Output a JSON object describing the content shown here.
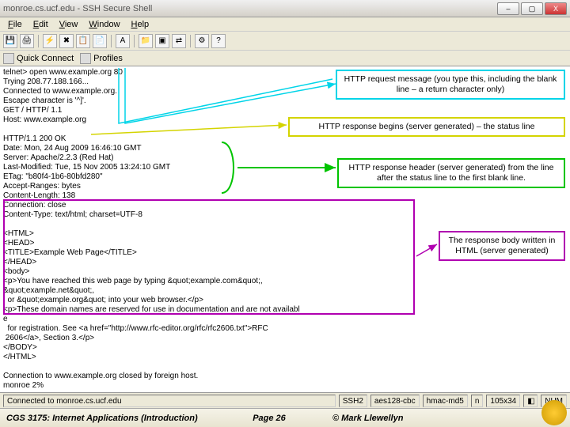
{
  "window": {
    "title": "monroe.cs.ucf.edu - SSH Secure Shell",
    "menus": [
      "File",
      "Edit",
      "View",
      "Window",
      "Help"
    ],
    "quickbar": {
      "connect": "Quick Connect",
      "profiles": "Profiles"
    }
  },
  "terminal": {
    "request": [
      "telnet> open www.example.org 80",
      "Trying 208.77.188.166...",
      "Connected to www.example.org.",
      "Escape character is '^]'.",
      "GET / HTTP/ 1.1",
      "Host: www.example.org",
      ""
    ],
    "status": "HTTP/1.1 200 OK",
    "headers": [
      "Date: Mon, 24 Aug 2009 16:46:10 GMT",
      "Server: Apache/2.2.3 (Red Hat)",
      "Last-Modified: Tue, 15 Nov 2005 13:24:10 GMT",
      "ETag: \"b80f4-1b6-80bfd280\"",
      "Accept-Ranges: bytes",
      "Content-Length: 138",
      "Connection: close",
      "Content-Type: text/html; charset=UTF-8"
    ],
    "body": [
      "<HTML>",
      "<HEAD>",
      "<TITLE>Example Web Page</TITLE>",
      "</HEAD>",
      "<body>",
      "<p>You have reached this web page by typing &quot;example.com&quot;,",
      "&quot;example.net&quot;,",
      "  or &quot;example.org&quot; into your web browser.</p>",
      "<p>These domain names are reserved for use in documentation and are not availabl",
      "e",
      "  for registration. See <a href=\"http://www.rfc-editor.org/rfc/rfc2606.txt\">RFC",
      " 2606</a>, Section 3.</p>",
      "</BODY>",
      "</HTML>",
      "",
      "Connection to www.example.org closed by foreign host.",
      "monroe 2%"
    ]
  },
  "callouts": {
    "c1": "HTTP request message (you type this, including the blank line – a return character only)",
    "c2": "HTTP response begins (server generated) – the status line",
    "c3": "HTTP response header (server generated) from the line after the status line to the first blank line.",
    "c4": "The response body written in HTML (server generated)"
  },
  "status": {
    "conn": "Connected to monroe.cs.ucf.edu",
    "s1": "SSH2",
    "s2": "aes128-cbc",
    "s3": "hmac-md5",
    "s4": "n",
    "s5": "105x34",
    "num": "NUM"
  },
  "footer": {
    "left": "CGS 3175: Internet Applications (Introduction)",
    "mid": "Page 26",
    "right": "© Mark Llewellyn"
  }
}
